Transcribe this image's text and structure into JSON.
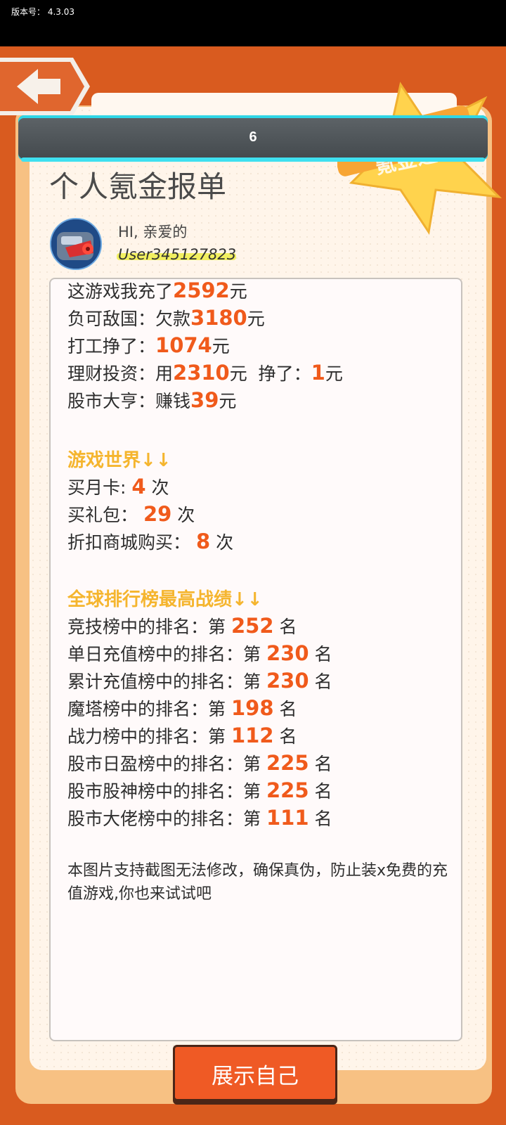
{
  "statusbar": {
    "version_label": "版本号：",
    "version_value": "4.3.03"
  },
  "header": {
    "title_number": "6",
    "back_icon": "arrow-left-icon"
  },
  "badge": {
    "text": "氪金之王"
  },
  "page": {
    "title": "个人氪金报单"
  },
  "user": {
    "greeting": "HI, 亲爱的",
    "username": "User345127823"
  },
  "summary": {
    "recharge": {
      "prefix": "这游戏我充了",
      "value": "2592",
      "suffix": "元"
    },
    "debt": {
      "prefix": "负可敌国：欠款",
      "value": "3180",
      "suffix": "元"
    },
    "work": {
      "prefix": "打工挣了：",
      "value": "1074",
      "suffix": "元"
    },
    "invest": {
      "prefix": "理财投资：用",
      "value": "2310",
      "mid": "元  挣了：",
      "value2": "1",
      "suffix": "元"
    },
    "stock": {
      "prefix": "股市大亨：赚钱",
      "value": "39",
      "suffix": "元"
    }
  },
  "game_world": {
    "title": "游戏世界↓↓",
    "monthly_card": {
      "prefix": "买月卡:",
      "value": "4",
      "suffix": "次"
    },
    "gift_pack": {
      "prefix": "买礼包：",
      "value": "29",
      "suffix": "次"
    },
    "discount_shop": {
      "prefix": "折扣商城购买：",
      "value": "8",
      "suffix": "次"
    }
  },
  "ranking": {
    "title": "全球排行榜最高战绩↓↓",
    "items": [
      {
        "prefix": "竞技榜中的排名：第",
        "value": "252",
        "suffix": "名"
      },
      {
        "prefix": "单日充值榜中的排名：第",
        "value": "230",
        "suffix": "名"
      },
      {
        "prefix": "累计充值榜中的排名：第",
        "value": "230",
        "suffix": "名"
      },
      {
        "prefix": "魔塔榜中的排名：第",
        "value": "198",
        "suffix": "名"
      },
      {
        "prefix": "战力榜中的排名：第",
        "value": "112",
        "suffix": "名"
      },
      {
        "prefix": "股市日盈榜中的排名：第",
        "value": "225",
        "suffix": "名"
      },
      {
        "prefix": "股市股神榜中的排名：第",
        "value": "225",
        "suffix": "名"
      },
      {
        "prefix": "股市大佬榜中的排名：第",
        "value": "111",
        "suffix": "名"
      }
    ]
  },
  "footnote": "本图片支持截图无法修改，确保真伪，防止装x免费的充值游戏,你也来试试吧",
  "actions": {
    "show_button": "展示自己"
  },
  "colors": {
    "accent": "#f05a1b",
    "section": "#f5b52e",
    "background": "#d95b1f",
    "button": "#ef5a25"
  }
}
